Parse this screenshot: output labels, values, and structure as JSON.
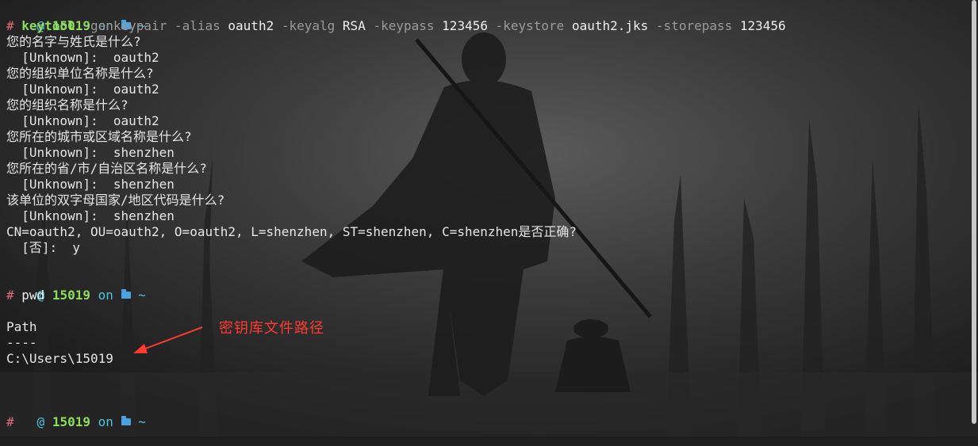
{
  "prompt": {
    "at_symbol": "@",
    "user": "15019",
    "on_word": "on",
    "folder_icon": "folder-icon",
    "tilde": "~",
    "hash": "#"
  },
  "command1": {
    "name": "keytool",
    "flag_genkeypair": "-genkeypair",
    "flag_alias": "-alias",
    "alias_value": "oauth2",
    "flag_keyalg": "-keyalg",
    "keyalg_value": "RSA",
    "flag_keypass": "-keypass",
    "keypass_value": "123456",
    "flag_keystore": "-keystore",
    "keystore_value": "oauth2.jks",
    "flag_storepass": "-storepass",
    "storepass_value": "123456"
  },
  "output1": [
    "您的名字与姓氏是什么?",
    "  [Unknown]:  oauth2",
    "您的组织单位名称是什么?",
    "  [Unknown]:  oauth2",
    "您的组织名称是什么?",
    "  [Unknown]:  oauth2",
    "您所在的城市或区域名称是什么?",
    "  [Unknown]:  shenzhen",
    "您所在的省/市/自治区名称是什么?",
    "  [Unknown]:  shenzhen",
    "该单位的双字母国家/地区代码是什么?",
    "  [Unknown]:  shenzhen",
    "CN=oauth2, OU=oauth2, O=oauth2, L=shenzhen, ST=shenzhen, C=shenzhen是否正确?",
    "  [否]:  y"
  ],
  "command2": "pwd",
  "output2": [
    "Path",
    "----",
    "C:\\Users\\15019"
  ],
  "annotation": "密钥库文件路径",
  "colors": {
    "prompt_cyan": "#4fc3e0",
    "user_green": "#8ddc5c",
    "hash_pink": "#e06c75",
    "annotation_red": "#ff3b30"
  }
}
